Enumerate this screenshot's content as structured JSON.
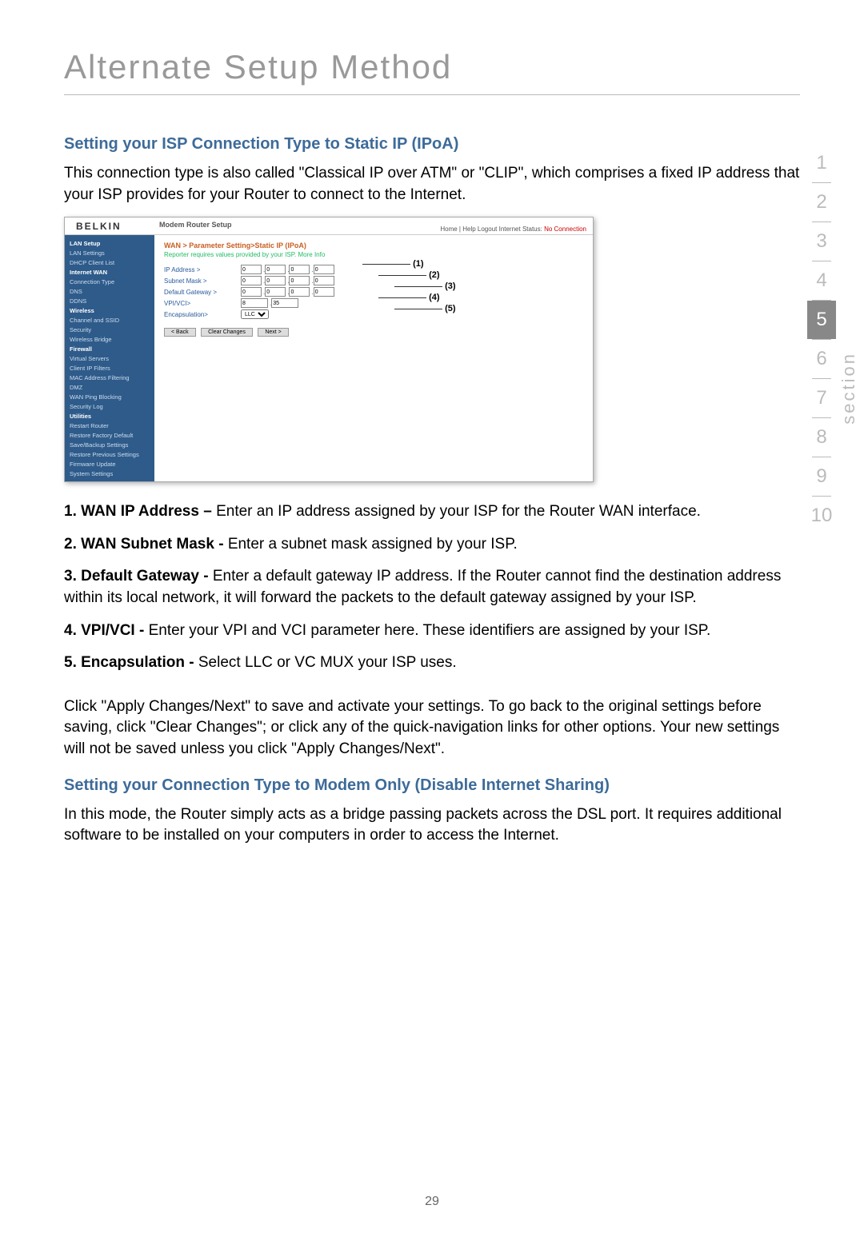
{
  "title": "Alternate Setup Method",
  "section1": {
    "heading": "Setting your ISP Connection Type to Static IP (IPoA)",
    "intro": "This connection type is also called \"Classical IP over ATM\" or \"CLIP\", which comprises a fixed IP address that your ISP provides for your Router to connect to the Internet."
  },
  "router_ui": {
    "logo": "BELKIN",
    "header_title": "Modem Router Setup",
    "header_links": "Home | Help  Logout  Internet Status:",
    "header_status": "No Connection",
    "sidebar": {
      "cats": [
        {
          "cat": "LAN Setup",
          "items": [
            "LAN Settings",
            "DHCP Client List"
          ]
        },
        {
          "cat": "Internet WAN",
          "items": [
            "Connection Type",
            "DNS",
            "DDNS"
          ]
        },
        {
          "cat": "Wireless",
          "items": [
            "Channel and SSID",
            "Security",
            "Wireless Bridge"
          ]
        },
        {
          "cat": "Firewall",
          "items": [
            "Virtual Servers",
            "Client IP Filters",
            "MAC Address Filtering",
            "DMZ",
            "WAN Ping Blocking",
            "Security Log"
          ]
        },
        {
          "cat": "Utilities",
          "items": [
            "Restart Router",
            "Restore Factory Default",
            "Save/Backup Settings",
            "Restore Previous Settings",
            "Firmware Update",
            "System Settings"
          ]
        }
      ]
    },
    "crumb": "WAN > Parameter Setting>Static IP (IPoA)",
    "hint": "Reporter requires values provided by your ISP. More Info",
    "rows": [
      {
        "label": "IP Address >",
        "fields": 4,
        "val": "0"
      },
      {
        "label": "Subnet Mask >",
        "fields": 4,
        "val": "0"
      },
      {
        "label": "Default Gateway >",
        "fields": 4,
        "val": "0"
      }
    ],
    "vpi_label": "VPI/VCI>",
    "vpi_vals": [
      "8",
      "35"
    ],
    "encap_label": "Encapsulation>",
    "encap_val": "LLC",
    "buttons": [
      "< Back",
      "Clear Changes",
      "Next >"
    ],
    "callouts": [
      "(1)",
      "(2)",
      "(3)",
      "(4)",
      "(5)"
    ]
  },
  "items": [
    {
      "bold": "1. WAN IP Address – ",
      "text": "Enter an IP address assigned by your ISP for the Router WAN interface."
    },
    {
      "bold": "2. WAN Subnet Mask - ",
      "text": "Enter a subnet mask assigned by your ISP."
    },
    {
      "bold": "3. Default Gateway - ",
      "text": "Enter a default gateway IP address. If the Router cannot find the destination address within its local network, it will forward the packets to the default gateway assigned by your ISP."
    },
    {
      "bold": "4. VPI/VCI - ",
      "text": "Enter your VPI and VCI parameter here. These identifiers are assigned by your ISP."
    },
    {
      "bold": "5. Encapsulation - ",
      "text": "Select LLC or VC MUX your ISP uses."
    }
  ],
  "apply_text": "Click \"Apply Changes/Next\" to save and activate your settings. To go back to the original settings before saving, click \"Clear Changes\"; or click any of the quick-navigation links for other options. Your new settings will not be saved unless you click \"Apply Changes/Next\".",
  "section2": {
    "heading": "Setting your Connection Type to Modem Only (Disable Internet Sharing)",
    "text": "In this mode, the Router simply acts as a bridge passing packets across the DSL port. It requires additional software to be installed on your computers in order to access the Internet."
  },
  "page_number": "29",
  "nav": [
    "1",
    "2",
    "3",
    "4",
    "5",
    "6",
    "7",
    "8",
    "9",
    "10"
  ],
  "nav_active_index": 4,
  "section_label": "section"
}
